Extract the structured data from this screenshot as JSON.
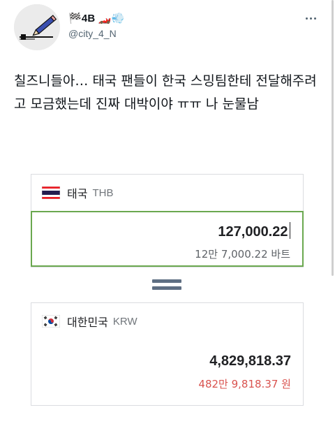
{
  "tweet": {
    "display_name": "🏁4B 🏎️💨",
    "handle": "@city_4_N",
    "text": "칠즈니들아… 태국 팬들이 한국 스밍팀한테 전달해주려고 모금했는데 진짜 대박이야 ㅠㅠ 나 눈물남",
    "avatar_icon": "pencil-drawing-icon"
  },
  "converter": {
    "from": {
      "currency_name": "태국",
      "currency_code": "THB",
      "amount": "127,000.22",
      "amount_words": "12만 7,000.22 바트",
      "flag_icon": "thailand-flag-icon"
    },
    "to": {
      "currency_name": "대한민국",
      "currency_code": "KRW",
      "amount": "4,829,818.37",
      "amount_words": "482만 9,818.37 원",
      "flag_icon": "south-korea-flag-icon"
    },
    "equals_icon": "equals-icon"
  },
  "colors": {
    "input_border": "#6aa84f",
    "converted_words": "#d9534f",
    "handle": "#536471",
    "equals": "#5f6f83"
  }
}
